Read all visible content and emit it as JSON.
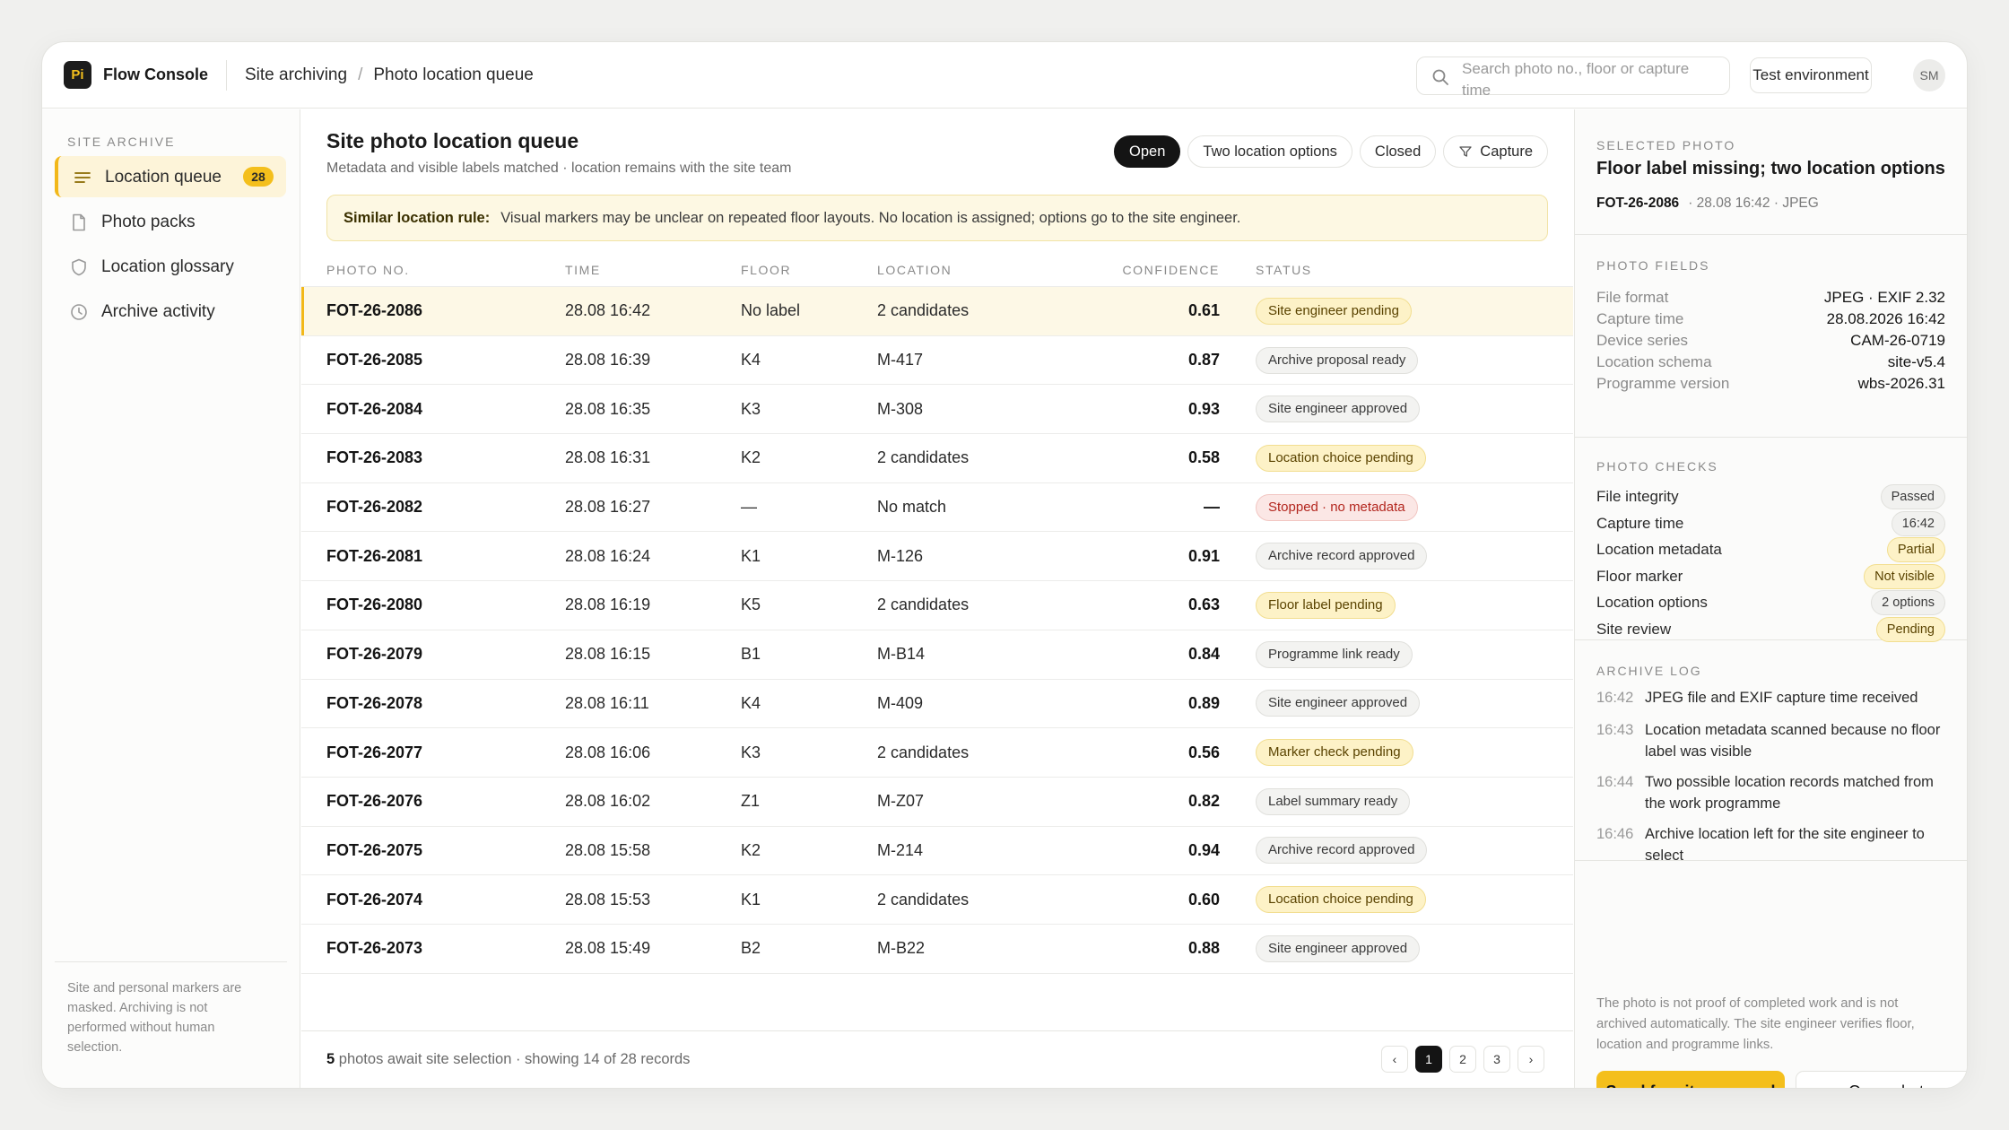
{
  "header": {
    "logo_text": "Pi",
    "app_name": "Flow Console",
    "breadcrumb": [
      "Site archiving",
      "Photo location queue"
    ],
    "search_placeholder": "Search photo no., floor or capture time",
    "env_label": "Test environment",
    "avatar": "SM"
  },
  "sidebar": {
    "heading": "SITE ARCHIVE",
    "items": [
      {
        "label": "Location queue",
        "icon": "list-icon",
        "badge": "28",
        "active": true
      },
      {
        "label": "Photo packs",
        "icon": "document-icon"
      },
      {
        "label": "Location glossary",
        "icon": "shield-icon"
      },
      {
        "label": "Archive activity",
        "icon": "clock-icon"
      }
    ],
    "footer_note": "Site and personal markers are masked. Archiving is not performed without human selection."
  },
  "main": {
    "title": "Site photo location queue",
    "subtitle": "Metadata and visible labels matched · location remains with the site team",
    "filters": [
      "Open",
      "Two location options",
      "Closed",
      "Capture"
    ],
    "active_filter": "Open",
    "rule": {
      "label": "Similar location rule:",
      "text": "Visual markers may be unclear on repeated floor layouts. No location is assigned; options go to the site engineer."
    },
    "columns": [
      "PHOTO NO.",
      "TIME",
      "FLOOR",
      "LOCATION",
      "CONFIDENCE",
      "STATUS"
    ],
    "rows": [
      {
        "no": "FOT-26-2086",
        "time": "28.08 16:42",
        "floor": "No label",
        "location": "2 candidates",
        "confidence": "0.61",
        "status": "Site engineer pending",
        "tone": "yellow",
        "selected": true
      },
      {
        "no": "FOT-26-2085",
        "time": "28.08 16:39",
        "floor": "K4",
        "location": "M-417",
        "confidence": "0.87",
        "status": "Archive proposal ready",
        "tone": "gray"
      },
      {
        "no": "FOT-26-2084",
        "time": "28.08 16:35",
        "floor": "K3",
        "location": "M-308",
        "confidence": "0.93",
        "status": "Site engineer approved",
        "tone": "gray"
      },
      {
        "no": "FOT-26-2083",
        "time": "28.08 16:31",
        "floor": "K2",
        "location": "2 candidates",
        "confidence": "0.58",
        "status": "Location choice pending",
        "tone": "yellow"
      },
      {
        "no": "FOT-26-2082",
        "time": "28.08 16:27",
        "floor": "—",
        "location": "No match",
        "confidence": "—",
        "status": "Stopped · no metadata",
        "tone": "red"
      },
      {
        "no": "FOT-26-2081",
        "time": "28.08 16:24",
        "floor": "K1",
        "location": "M-126",
        "confidence": "0.91",
        "status": "Archive record approved",
        "tone": "gray"
      },
      {
        "no": "FOT-26-2080",
        "time": "28.08 16:19",
        "floor": "K5",
        "location": "2 candidates",
        "confidence": "0.63",
        "status": "Floor label pending",
        "tone": "yellow"
      },
      {
        "no": "FOT-26-2079",
        "time": "28.08 16:15",
        "floor": "B1",
        "location": "M-B14",
        "confidence": "0.84",
        "status": "Programme link ready",
        "tone": "gray"
      },
      {
        "no": "FOT-26-2078",
        "time": "28.08 16:11",
        "floor": "K4",
        "location": "M-409",
        "confidence": "0.89",
        "status": "Site engineer approved",
        "tone": "gray"
      },
      {
        "no": "FOT-26-2077",
        "time": "28.08 16:06",
        "floor": "K3",
        "location": "2 candidates",
        "confidence": "0.56",
        "status": "Marker check pending",
        "tone": "yellow"
      },
      {
        "no": "FOT-26-2076",
        "time": "28.08 16:02",
        "floor": "Z1",
        "location": "M-Z07",
        "confidence": "0.82",
        "status": "Label summary ready",
        "tone": "gray"
      },
      {
        "no": "FOT-26-2075",
        "time": "28.08 15:58",
        "floor": "K2",
        "location": "M-214",
        "confidence": "0.94",
        "status": "Archive record approved",
        "tone": "gray"
      },
      {
        "no": "FOT-26-2074",
        "time": "28.08 15:53",
        "floor": "K1",
        "location": "2 candidates",
        "confidence": "0.60",
        "status": "Location choice pending",
        "tone": "yellow"
      },
      {
        "no": "FOT-26-2073",
        "time": "28.08 15:49",
        "floor": "B2",
        "location": "M-B22",
        "confidence": "0.88",
        "status": "Site engineer approved",
        "tone": "gray"
      }
    ],
    "footer": {
      "count": "5",
      "text": "photos await site selection · showing 14 of 28 records"
    },
    "pagination": {
      "prev": "‹",
      "pages": [
        "1",
        "2",
        "3"
      ],
      "current": "1",
      "next": "›"
    }
  },
  "panel": {
    "selected_label": "SELECTED PHOTO",
    "selected_title": "Floor label missing; two location options",
    "selected_no": "FOT-26-2086",
    "selected_meta": "28.08 16:42 · JPEG",
    "fields_label": "PHOTO FIELDS",
    "fields": [
      {
        "key": "File format",
        "value": "JPEG · EXIF 2.32"
      },
      {
        "key": "Capture time",
        "value": "28.08.2026 16:42"
      },
      {
        "key": "Device series",
        "value": "CAM-26-0719"
      },
      {
        "key": "Location schema",
        "value": "site-v5.4"
      },
      {
        "key": "Programme version",
        "value": "wbs-2026.31"
      }
    ],
    "checks_label": "PHOTO CHECKS",
    "checks": [
      {
        "key": "File integrity",
        "value": "Passed",
        "tone": "gray"
      },
      {
        "key": "Capture time",
        "value": "16:42",
        "tone": "gray"
      },
      {
        "key": "Location metadata",
        "value": "Partial",
        "tone": "yellow"
      },
      {
        "key": "Floor marker",
        "value": "Not visible",
        "tone": "yellow"
      },
      {
        "key": "Location options",
        "value": "2 options",
        "tone": "gray"
      },
      {
        "key": "Site review",
        "value": "Pending",
        "tone": "yellow"
      }
    ],
    "log_label": "ARCHIVE LOG",
    "log": [
      {
        "time": "16:42",
        "text": "JPEG file and EXIF capture time received"
      },
      {
        "time": "16:43",
        "text": "Location metadata scanned because no floor label was visible"
      },
      {
        "time": "16:44",
        "text": "Two possible location records matched from the work programme"
      },
      {
        "time": "16:46",
        "text": "Archive location left for the site engineer to select"
      }
    ],
    "note": "The photo is not proof of completed work and is not archived automatically. The site engineer verifies floor, location and programme links.",
    "primary_button": "Send for site approval",
    "secondary_button": "Open photo"
  },
  "colors": {
    "accent": "#f4bf1c",
    "accent_soft": "#fdf4d9",
    "danger": "#b3261e",
    "ink": "#141414"
  }
}
